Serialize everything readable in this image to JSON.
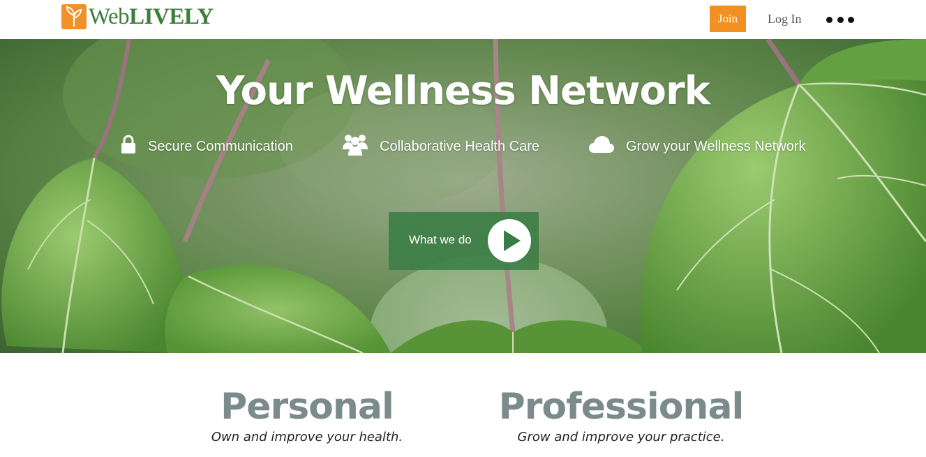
{
  "brand": {
    "name_regular": "Web",
    "name_bold": "LIVELY",
    "logo_icon": "sprout-icon"
  },
  "header": {
    "join_label": "Join",
    "login_label": "Log In",
    "more_icon": "more-dots-icon"
  },
  "hero": {
    "title": "Your Wellness Network",
    "features": [
      {
        "icon": "lock-icon",
        "label": "Secure Communication"
      },
      {
        "icon": "users-icon",
        "label": "Collaborative Health Care"
      },
      {
        "icon": "cloud-icon",
        "label": "Grow your Wellness Network"
      }
    ],
    "cta_label": "What we do",
    "cta_icon": "play-icon"
  },
  "sections": {
    "personal": {
      "title": "Personal",
      "subtitle": "Own and improve your health."
    },
    "professional": {
      "title": "Professional",
      "subtitle": "Grow and improve your practice."
    }
  },
  "colors": {
    "brand_green": "#3e7d3c",
    "accent_orange": "#f39024",
    "cta_green": "#3a7d44",
    "heading_gray": "#7b8a8b"
  }
}
